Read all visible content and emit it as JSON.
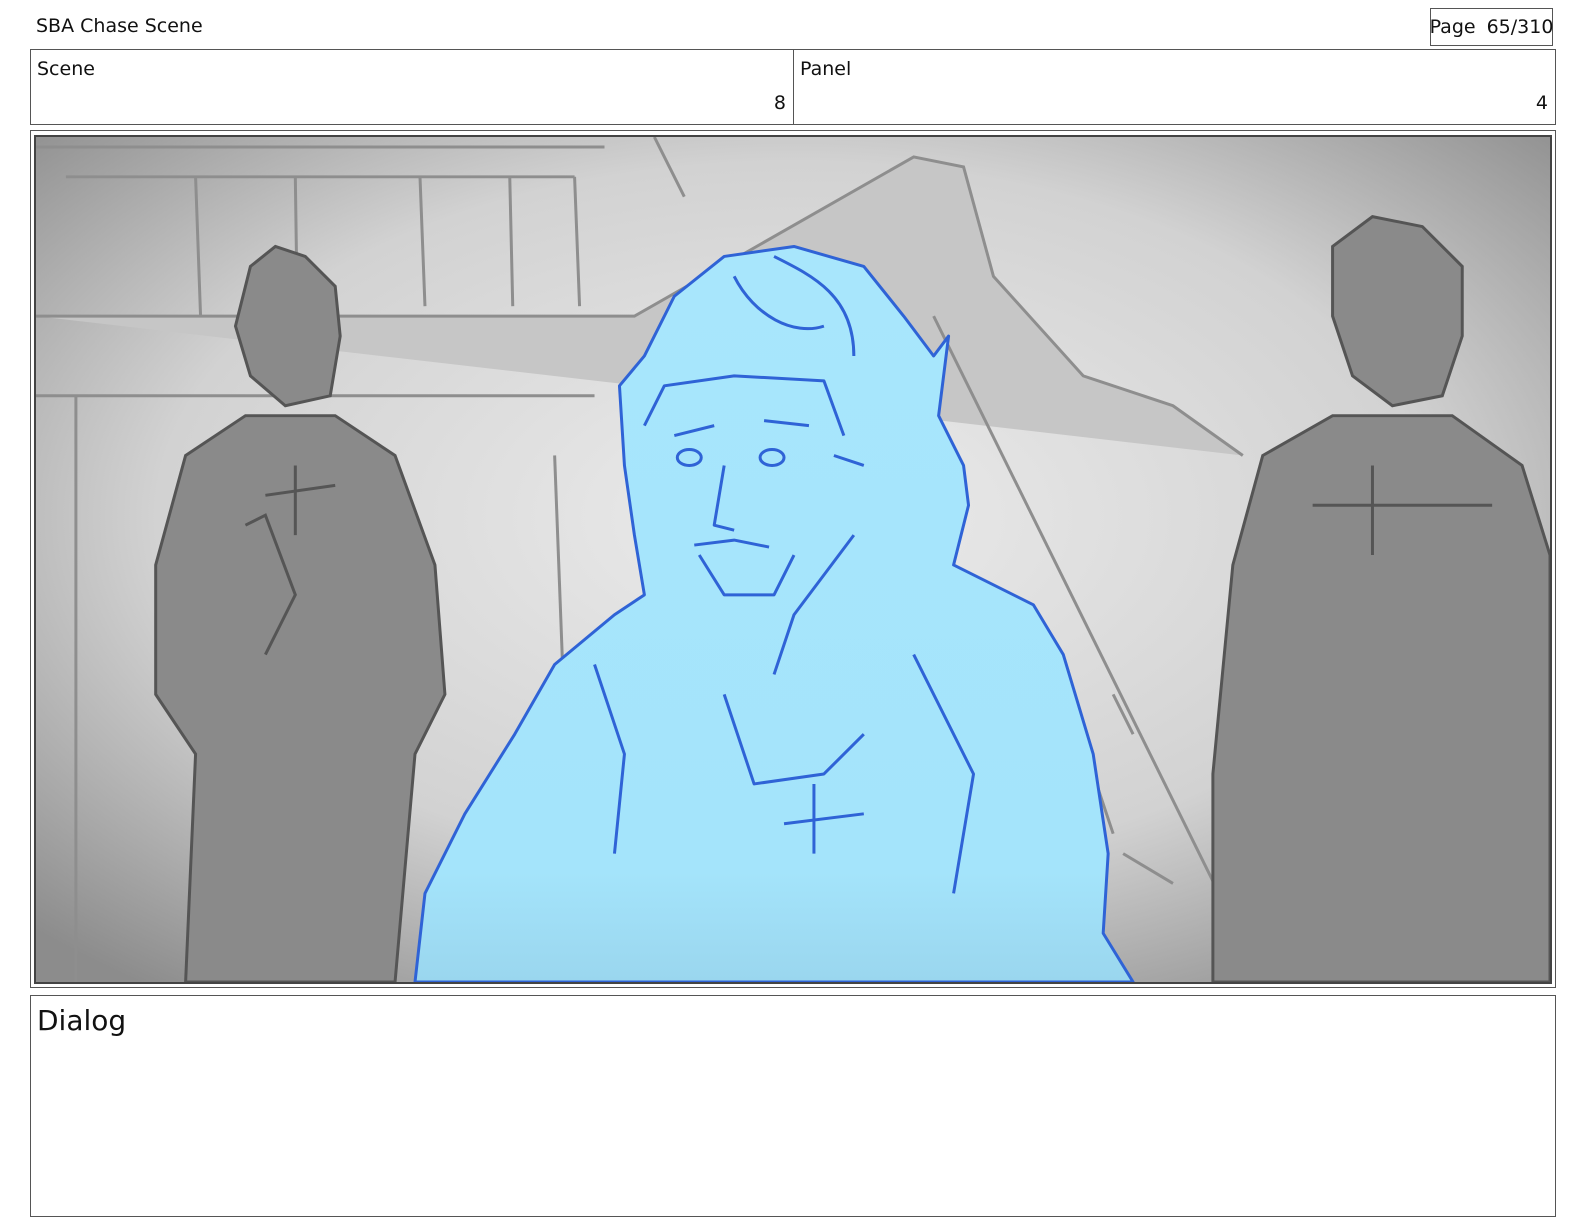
{
  "header": {
    "title": "SBA Chase Scene",
    "page_label": "Page",
    "page_number": "65/310"
  },
  "info": {
    "scene_label": "Scene",
    "scene_value": "8",
    "panel_label": "Panel",
    "panel_value": "4"
  },
  "artwork": {
    "description_icon": "storyboard-sketch",
    "highlight_color": "#a6e4fb",
    "line_color": "#2f63d6",
    "gray_figure_color": "#8a8a8a"
  },
  "dialog": {
    "label": "Dialog"
  }
}
